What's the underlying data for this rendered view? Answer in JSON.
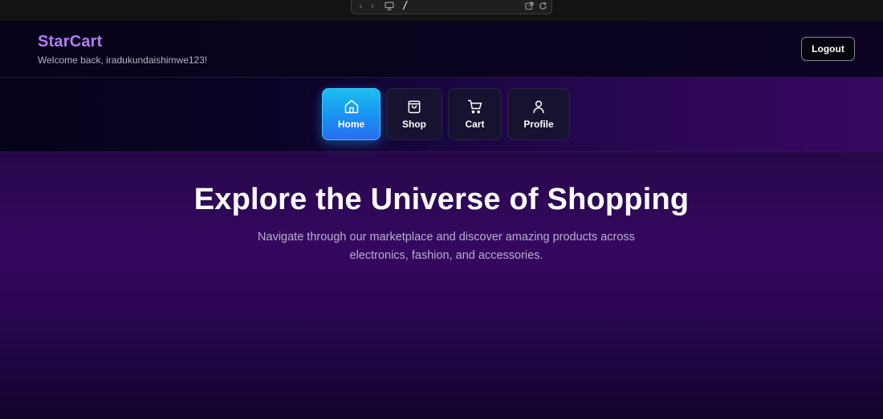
{
  "browser": {
    "url_path": "/",
    "icons": [
      "back-icon",
      "forward-icon",
      "monitor-icon",
      "external-link-icon",
      "reload-icon"
    ]
  },
  "header": {
    "brand": "StarCart",
    "welcome": "Welcome back, iradukundaishimwe123!",
    "logout_label": "Logout"
  },
  "nav": {
    "items": [
      {
        "label": "Home",
        "icon": "home-icon",
        "active": true
      },
      {
        "label": "Shop",
        "icon": "shopping-bag-icon",
        "active": false
      },
      {
        "label": "Cart",
        "icon": "cart-icon",
        "active": false
      },
      {
        "label": "Profile",
        "icon": "user-icon",
        "active": false
      }
    ]
  },
  "hero": {
    "title": "Explore the Universe of Shopping",
    "subtitle": "Navigate through our marketplace and discover amazing products across electronics, fashion, and accessories."
  },
  "colors": {
    "brand": "#b57cf2",
    "active_nav": "#1a8df2",
    "hero_bg": "#350860"
  }
}
